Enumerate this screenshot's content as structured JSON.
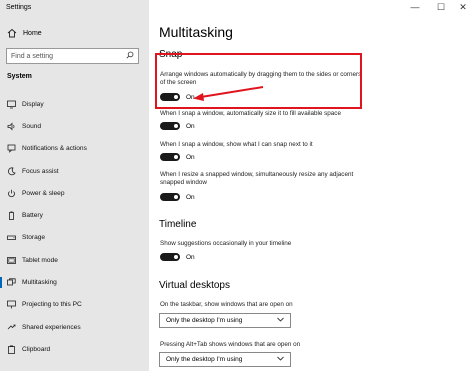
{
  "window": {
    "title": "Settings",
    "controls": [
      "—",
      "☐",
      "✕"
    ]
  },
  "sidebar": {
    "home_label": "Home",
    "search_placeholder": "Find a setting",
    "section_label": "System",
    "items": [
      {
        "label": "Display",
        "icon": "display-icon"
      },
      {
        "label": "Sound",
        "icon": "sound-icon"
      },
      {
        "label": "Notifications & actions",
        "icon": "notifications-icon"
      },
      {
        "label": "Focus assist",
        "icon": "focus-assist-icon"
      },
      {
        "label": "Power & sleep",
        "icon": "power-icon"
      },
      {
        "label": "Battery",
        "icon": "battery-icon"
      },
      {
        "label": "Storage",
        "icon": "storage-icon"
      },
      {
        "label": "Tablet mode",
        "icon": "tablet-icon"
      },
      {
        "label": "Multitasking",
        "icon": "multitasking-icon",
        "active": true
      },
      {
        "label": "Projecting to this PC",
        "icon": "projecting-icon"
      },
      {
        "label": "Shared experiences",
        "icon": "shared-icon"
      },
      {
        "label": "Clipboard",
        "icon": "clipboard-icon"
      }
    ]
  },
  "main": {
    "title": "Multitasking",
    "snap": {
      "title": "Snap",
      "settings": [
        {
          "label": "Arrange windows automatically by dragging them to the sides or corners of the screen",
          "state": "On"
        },
        {
          "label": "When I snap a window, automatically size it to fill available space",
          "state": "On"
        },
        {
          "label": "When I snap a window, show what I can snap next to it",
          "state": "On"
        },
        {
          "label": "When I resize a snapped window, simultaneously resize any adjacent snapped window",
          "state": "On"
        }
      ]
    },
    "timeline": {
      "title": "Timeline",
      "label": "Show suggestions occasionally in your timeline",
      "state": "On"
    },
    "virtual_desktops": {
      "title": "Virtual desktops",
      "taskbar_label": "On the taskbar, show windows that are open on",
      "taskbar_value": "Only the desktop I'm using",
      "alttab_label": "Pressing Alt+Tab shows windows that are open on",
      "alttab_value": "Only the desktop I'm using"
    }
  },
  "colors": {
    "accent": "#0067b8",
    "highlight": "#e0141e",
    "toggle_on": "#1a1a1a",
    "sidebar_bg": "#e6e6e6"
  }
}
